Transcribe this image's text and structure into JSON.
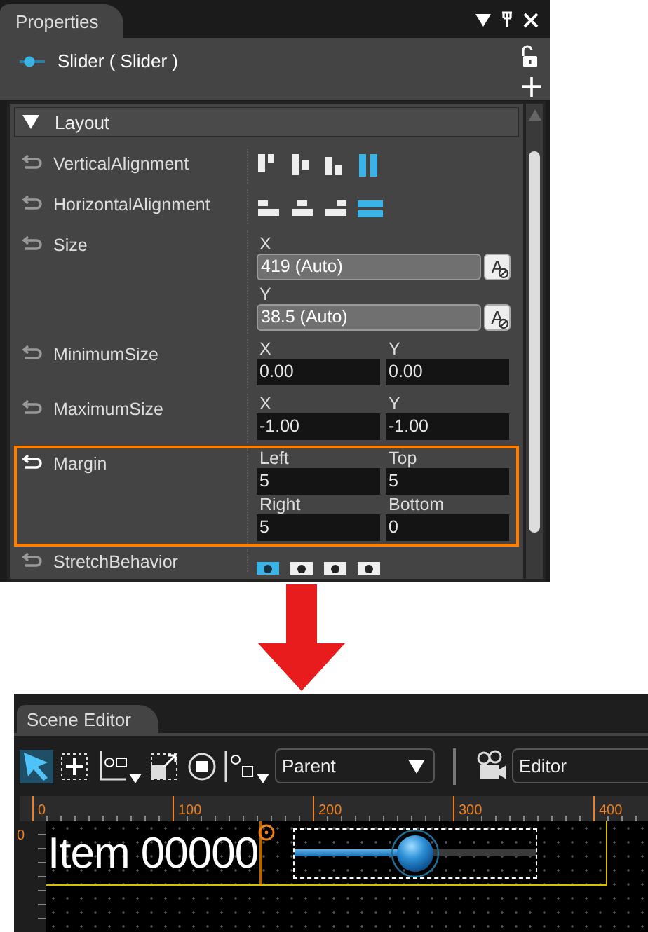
{
  "properties": {
    "title": "Properties",
    "object": "Slider ( Slider )",
    "section": {
      "title": "Layout",
      "expanded": true
    },
    "rows": [
      {
        "label": "VerticalAlignment",
        "kind": "valign",
        "modified": false,
        "highlighted": false,
        "options": [
          {
            "selected": false
          },
          {
            "selected": false
          },
          {
            "selected": false
          },
          {
            "selected": true
          }
        ]
      },
      {
        "label": "HorizontalAlignment",
        "kind": "halign",
        "modified": false,
        "highlighted": false,
        "options": [
          {
            "selected": false
          },
          {
            "selected": false
          },
          {
            "selected": false
          },
          {
            "selected": true
          }
        ]
      },
      {
        "label": "Size",
        "kind": "auto",
        "modified": false,
        "highlighted": false,
        "fields": [
          {
            "label": "X",
            "value": "419 (Auto)",
            "button": "A"
          },
          {
            "label": "Y",
            "value": "38.5 (Auto)",
            "button": "A"
          }
        ]
      },
      {
        "label": "MinimumSize",
        "kind": "grid",
        "modified": false,
        "highlighted": false,
        "fields": [
          {
            "label": "X",
            "value": "0.00"
          },
          {
            "label": "Y",
            "value": "0.00"
          }
        ]
      },
      {
        "label": "MaximumSize",
        "kind": "grid",
        "modified": false,
        "highlighted": false,
        "fields": [
          {
            "label": "X",
            "value": "-1.00"
          },
          {
            "label": "Y",
            "value": "-1.00"
          }
        ]
      },
      {
        "label": "Margin",
        "kind": "grid",
        "modified": true,
        "highlighted": true,
        "fields": [
          {
            "label": "Left",
            "value": "5"
          },
          {
            "label": "Top",
            "value": "5"
          },
          {
            "label": "Right",
            "value": "5"
          },
          {
            "label": "Bottom",
            "value": "0"
          }
        ]
      },
      {
        "label": "StretchBehavior",
        "kind": "stretch",
        "modified": false,
        "highlighted": false,
        "options": [
          {
            "selected": true
          },
          {
            "selected": false
          },
          {
            "selected": false
          },
          {
            "selected": false
          }
        ]
      }
    ]
  },
  "scene_editor": {
    "title": "Scene Editor",
    "tools": [
      {
        "selected": true
      },
      {
        "selected": false
      },
      {
        "selected": false
      },
      {
        "selected": false
      },
      {
        "selected": false
      },
      {
        "selected": false
      }
    ],
    "space_dropdown": "Parent",
    "camera_field": "Editor",
    "ruler": [
      "0",
      "100",
      "200",
      "300",
      "400"
    ],
    "vertical_ruler": "0",
    "item_text": "Item 00000",
    "slider": {
      "level": 0.5
    }
  }
}
